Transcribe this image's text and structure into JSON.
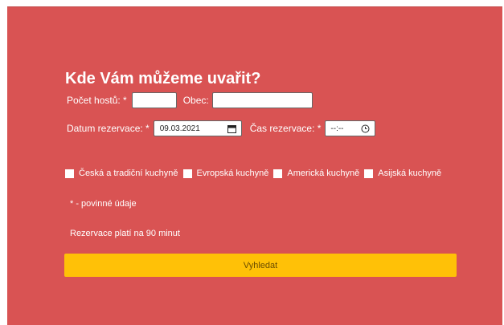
{
  "form": {
    "title": "Kde Vám můžeme uvařit?",
    "guests_label": "Počet hostů: *",
    "guests_value": "",
    "city_label": "Obec:",
    "city_value": "",
    "date_label": "Datum rezervace: *",
    "date_value": "09.03.2021",
    "time_label": "Čas rezervace: *",
    "time_value": "--:--",
    "cuisines": [
      {
        "label": "Česká a tradiční kuchyně",
        "checked": false
      },
      {
        "label": "Evropská kuchyně",
        "checked": false
      },
      {
        "label": "Americká kuchyně",
        "checked": false
      },
      {
        "label": "Asijská kuchyně",
        "checked": false
      }
    ],
    "required_note": "* - povinné údaje",
    "validity_note": "Rezervace platí na 90 minut",
    "search_label": "Vyhledat"
  },
  "icons": {
    "date": "calendar-icon",
    "time": "clock-icon"
  },
  "colors": {
    "panel_bg": "#d95353",
    "button_bg": "#ffc107",
    "button_text": "#6b4d00",
    "text": "#ffffff"
  }
}
